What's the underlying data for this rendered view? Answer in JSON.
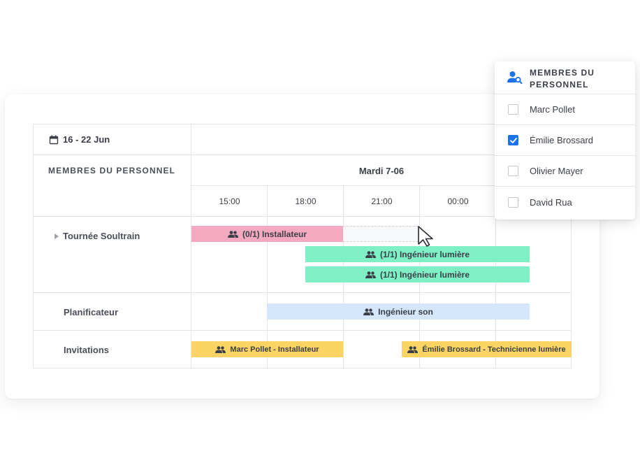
{
  "calendar": {
    "date_range": "16 - 22 Jun",
    "section_title": "MEMBRES DU PERSONNEL",
    "day_title": "Mardi 7-06",
    "times": [
      "15:00",
      "18:00",
      "21:00",
      "00:00"
    ]
  },
  "rows": [
    {
      "label": "Tournée Soultrain"
    },
    {
      "label": "Planificateur"
    },
    {
      "label": "Invitations"
    }
  ],
  "bars": {
    "installer_open": "(0/1) Installateur",
    "light_engineer_1": "(1/1) Ingénieur lumière",
    "light_engineer_2": "(1/1) Ingénieur lumière",
    "sound_engineer": "Ingénieur son",
    "invite_marc": "Marc Pollet - Installateur",
    "invite_emilie": "Émilie Brossard - Technicienne lumière"
  },
  "staff_panel": {
    "title": "MEMBRES DU PERSONNEL",
    "options": [
      {
        "label": "Marc Pollet",
        "checked": false
      },
      {
        "label": "Émilie Brossard",
        "checked": true
      },
      {
        "label": "Olivier Mayer",
        "checked": false
      },
      {
        "label": "David Rua",
        "checked": false
      }
    ]
  },
  "colors": {
    "pink": "#f5a9c0",
    "green": "#7fefc6",
    "blue": "#d4e6fb",
    "yellow": "#fbd463",
    "accent": "#1a73e8"
  }
}
